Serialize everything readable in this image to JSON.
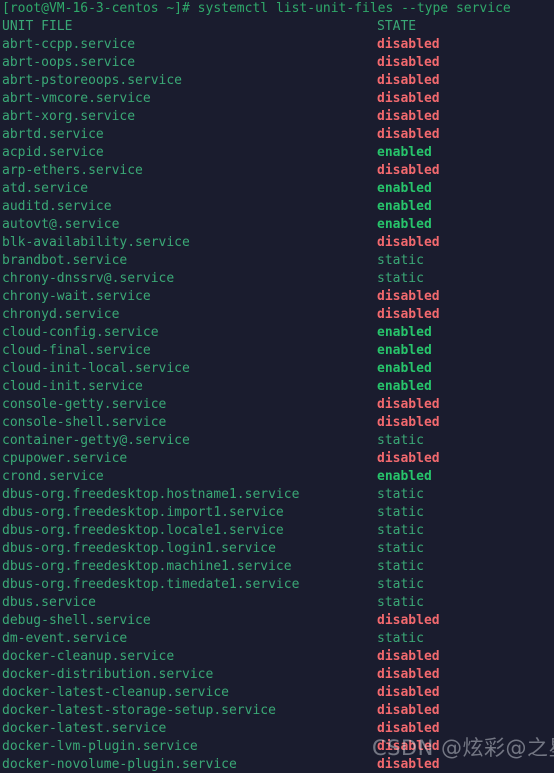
{
  "terminal": {
    "background_color": "#1a1c2e",
    "prompt": "[root@VM-16-3-centos ~]#",
    "command": "systemctl list-unit-files --type service",
    "colors": {
      "unit_name": "#3aa876",
      "enabled": "#27c46b",
      "disabled": "#f2696e",
      "static": "#3aa876",
      "prompt": "#2fa86a"
    },
    "headers": {
      "unit_file": "UNIT FILE",
      "state": "STATE"
    },
    "rows": [
      {
        "unit": "abrt-ccpp.service",
        "state": "disabled"
      },
      {
        "unit": "abrt-oops.service",
        "state": "disabled"
      },
      {
        "unit": "abrt-pstoreoops.service",
        "state": "disabled"
      },
      {
        "unit": "abrt-vmcore.service",
        "state": "disabled"
      },
      {
        "unit": "abrt-xorg.service",
        "state": "disabled"
      },
      {
        "unit": "abrtd.service",
        "state": "disabled"
      },
      {
        "unit": "acpid.service",
        "state": "enabled"
      },
      {
        "unit": "arp-ethers.service",
        "state": "disabled"
      },
      {
        "unit": "atd.service",
        "state": "enabled"
      },
      {
        "unit": "auditd.service",
        "state": "enabled"
      },
      {
        "unit": "autovt@.service",
        "state": "enabled"
      },
      {
        "unit": "blk-availability.service",
        "state": "disabled"
      },
      {
        "unit": "brandbot.service",
        "state": "static"
      },
      {
        "unit": "chrony-dnssrv@.service",
        "state": "static"
      },
      {
        "unit": "chrony-wait.service",
        "state": "disabled"
      },
      {
        "unit": "chronyd.service",
        "state": "disabled"
      },
      {
        "unit": "cloud-config.service",
        "state": "enabled"
      },
      {
        "unit": "cloud-final.service",
        "state": "enabled"
      },
      {
        "unit": "cloud-init-local.service",
        "state": "enabled"
      },
      {
        "unit": "cloud-init.service",
        "state": "enabled"
      },
      {
        "unit": "console-getty.service",
        "state": "disabled"
      },
      {
        "unit": "console-shell.service",
        "state": "disabled"
      },
      {
        "unit": "container-getty@.service",
        "state": "static"
      },
      {
        "unit": "cpupower.service",
        "state": "disabled"
      },
      {
        "unit": "crond.service",
        "state": "enabled"
      },
      {
        "unit": "dbus-org.freedesktop.hostname1.service",
        "state": "static"
      },
      {
        "unit": "dbus-org.freedesktop.import1.service",
        "state": "static"
      },
      {
        "unit": "dbus-org.freedesktop.locale1.service",
        "state": "static"
      },
      {
        "unit": "dbus-org.freedesktop.login1.service",
        "state": "static"
      },
      {
        "unit": "dbus-org.freedesktop.machine1.service",
        "state": "static"
      },
      {
        "unit": "dbus-org.freedesktop.timedate1.service",
        "state": "static"
      },
      {
        "unit": "dbus.service",
        "state": "static"
      },
      {
        "unit": "debug-shell.service",
        "state": "disabled"
      },
      {
        "unit": "dm-event.service",
        "state": "static"
      },
      {
        "unit": "docker-cleanup.service",
        "state": "disabled"
      },
      {
        "unit": "docker-distribution.service",
        "state": "disabled"
      },
      {
        "unit": "docker-latest-cleanup.service",
        "state": "disabled"
      },
      {
        "unit": "docker-latest-storage-setup.service",
        "state": "disabled"
      },
      {
        "unit": "docker-latest.service",
        "state": "disabled"
      },
      {
        "unit": "docker-lvm-plugin.service",
        "state": "disabled"
      },
      {
        "unit": "docker-novolume-plugin.service",
        "state": "disabled"
      }
    ]
  },
  "watermark": {
    "text": "CSDN @炫彩@之星"
  }
}
